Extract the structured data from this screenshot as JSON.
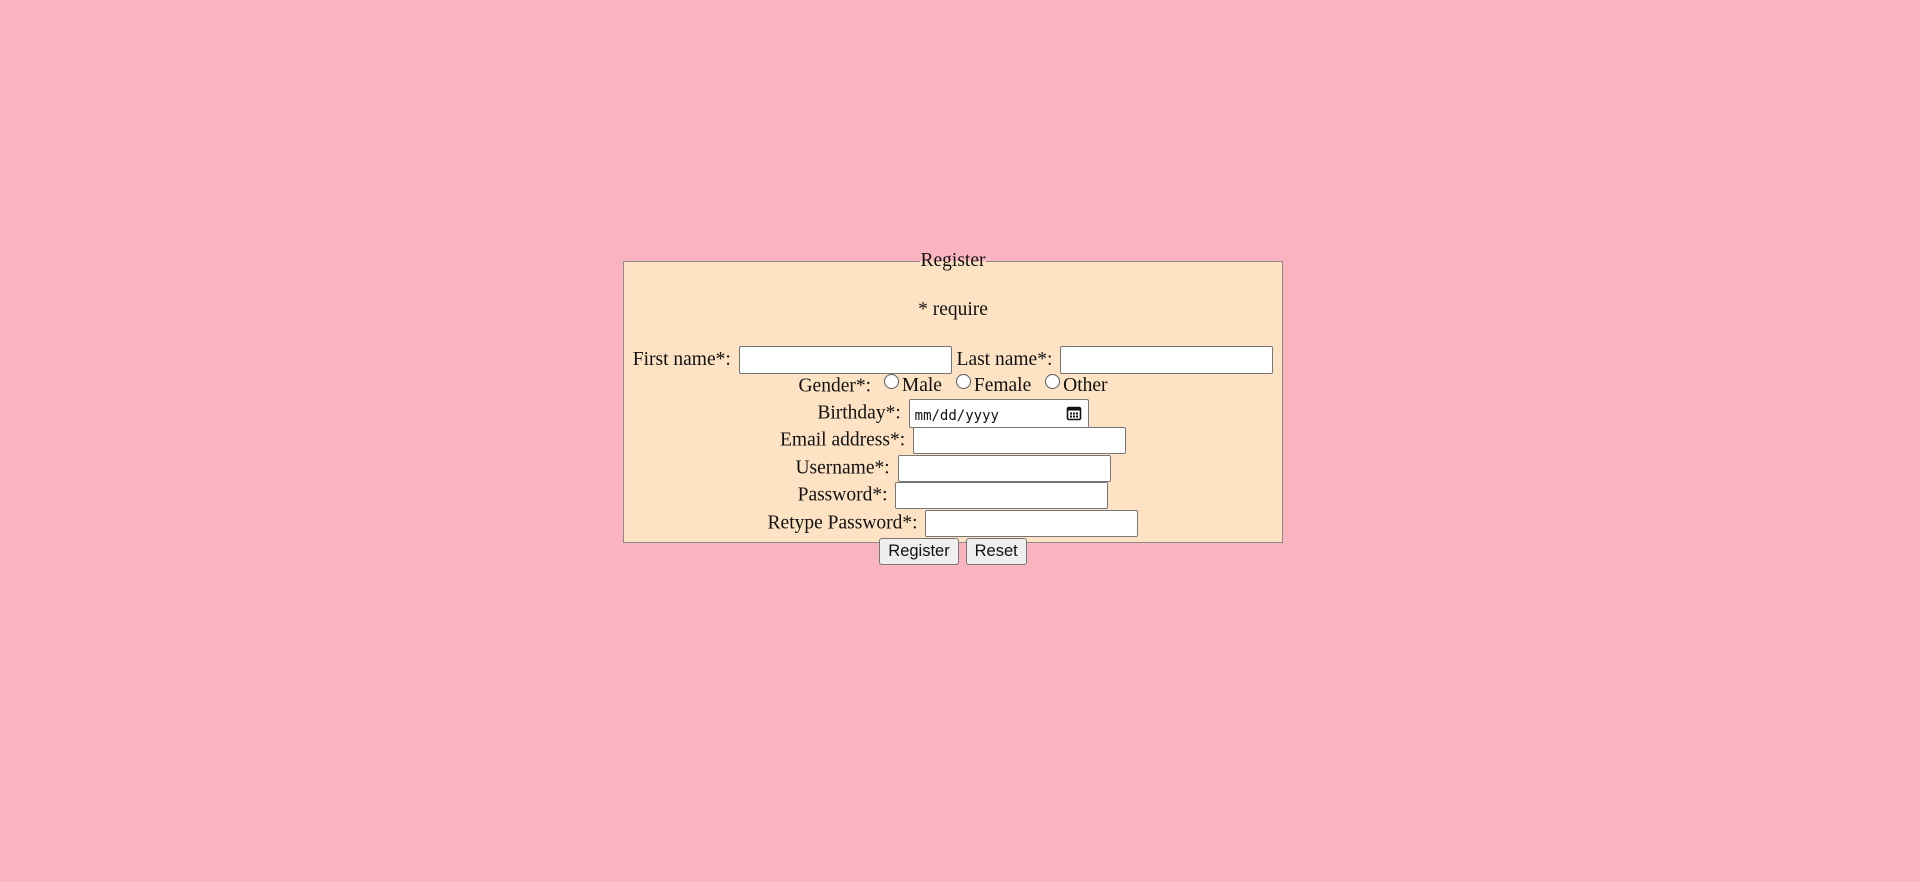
{
  "form": {
    "legend": "Register",
    "required_note": "* require",
    "first_name_label": "First name*:",
    "last_name_label": "Last name*:",
    "gender_label": "Gender*:",
    "gender_options": [
      "Male",
      "Female",
      "Other"
    ],
    "birthday_label": "Birthday*:",
    "birthday_placeholder": "mm/dd/yyyy",
    "email_label": "Email address*:",
    "username_label": "Username*:",
    "password_label": "Password*:",
    "retype_password_label": "Retype Password*:",
    "register_button": "Register",
    "reset_button": "Reset"
  },
  "colors": {
    "page_background": "#f9b4bf",
    "form_background": "#fde3c3"
  },
  "icons": {
    "birthday_picker": "calendar-icon"
  }
}
